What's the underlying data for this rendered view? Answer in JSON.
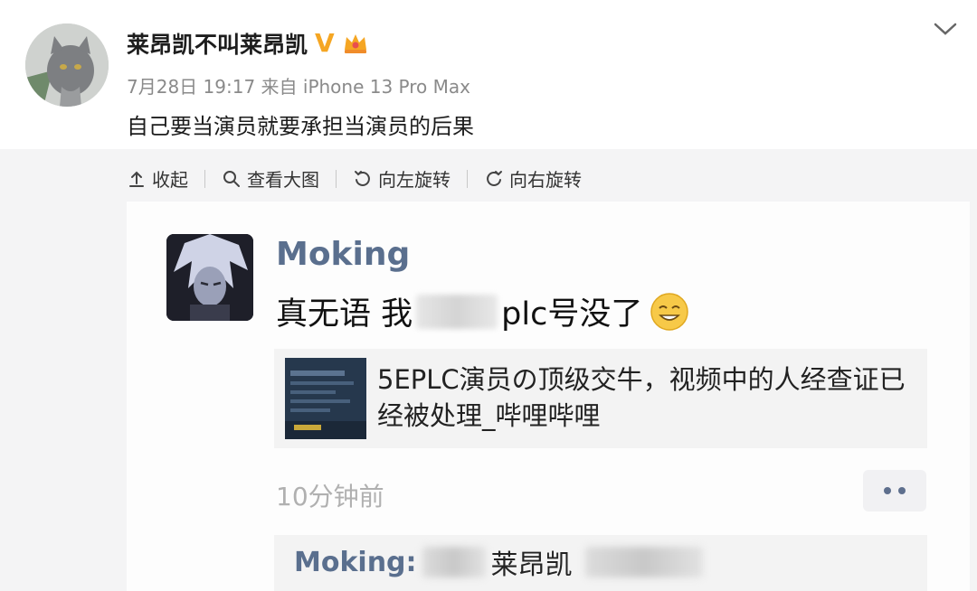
{
  "post": {
    "author_name": "莱昂凯不叫莱昂凯",
    "verified_mark": "V",
    "timestamp": "7月28日 19:17",
    "source": "来自 iPhone 13 Pro Max",
    "text": "自己要当演员就要承担当演员的后果"
  },
  "toolbar": {
    "collapse_label": "收起",
    "view_large_label": "查看大图",
    "rotate_left_label": "向左旋转",
    "rotate_right_label": "向右旋转"
  },
  "screenshot": {
    "name": "Moking",
    "text_before": "真无语 我",
    "text_after": "plc号没了",
    "link_title": "5EPLC演员の顶级交牛，视频中的人经查证已经被处理_哔哩哔哩",
    "time": "10分钟前",
    "comment_name": "Moking:",
    "comment_text": "莱昂凯"
  },
  "colors": {
    "accent_link": "#5a6f8e",
    "verified": "#f5a623",
    "media_bg": "#f4f4f5"
  },
  "icons": [
    "chevron-down-icon",
    "collapse-icon",
    "search-icon",
    "rotate-left-icon",
    "rotate-right-icon",
    "more-dots-icon"
  ]
}
